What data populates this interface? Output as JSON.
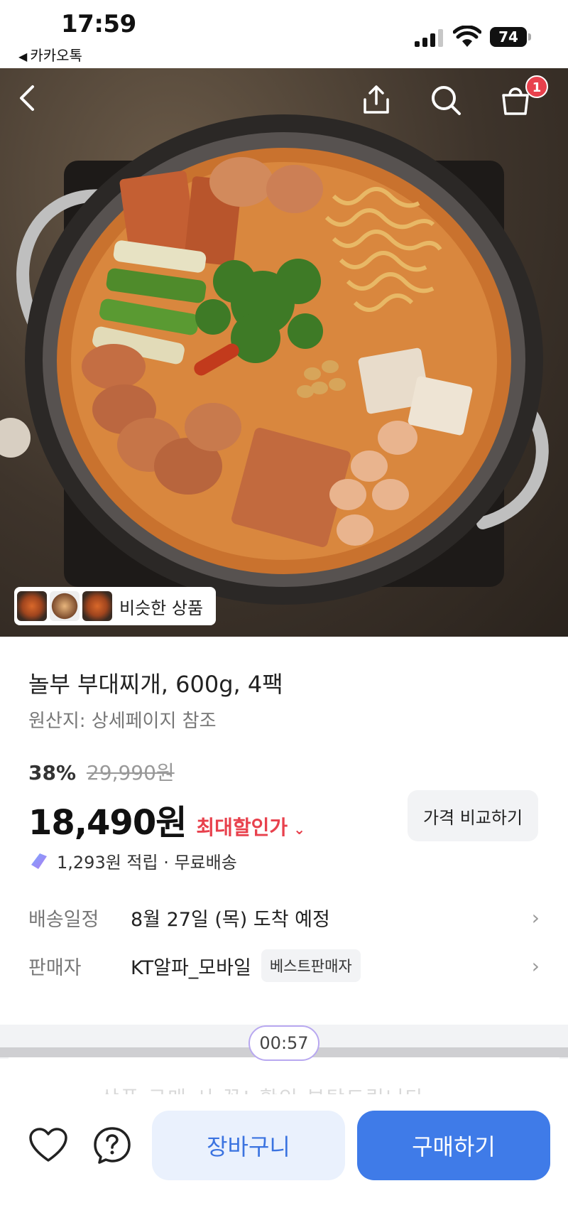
{
  "status_bar": {
    "time": "17:59",
    "back_app": "카카오톡",
    "battery": "74"
  },
  "header": {
    "icons": [
      "back-icon",
      "share-icon",
      "search-icon",
      "cart-icon"
    ],
    "cart_badge": "1"
  },
  "hero": {
    "similar_label": "비슷한 상품"
  },
  "product": {
    "title": "놀부 부대찌개, 600g, 4팩",
    "origin": "원산지: 상세페이지 참조",
    "discount_rate": "38%",
    "original_price": "29,990원",
    "price": "18,490원",
    "max_discount_label": "최대할인가",
    "compare_button": "가격 비교하기",
    "points": "1,293원 적립 · 무료배송"
  },
  "info": {
    "delivery_key": "배송일정",
    "delivery_value": "8월 27일 (목) 도착 예정",
    "seller_key": "판매자",
    "seller_value": "KT알파_모바일",
    "seller_badge": "베스트판매자"
  },
  "overlay": {
    "timer": "00:57",
    "peek_text": "상품 구매 시 꼭! 확인 부탁드립니다"
  },
  "actions": {
    "cart": "장바구니",
    "buy": "구매하기"
  },
  "colors": {
    "accent": "#3f7be8",
    "sale_red": "#e8414d",
    "cart_btn_bg": "#eaf1fd"
  }
}
